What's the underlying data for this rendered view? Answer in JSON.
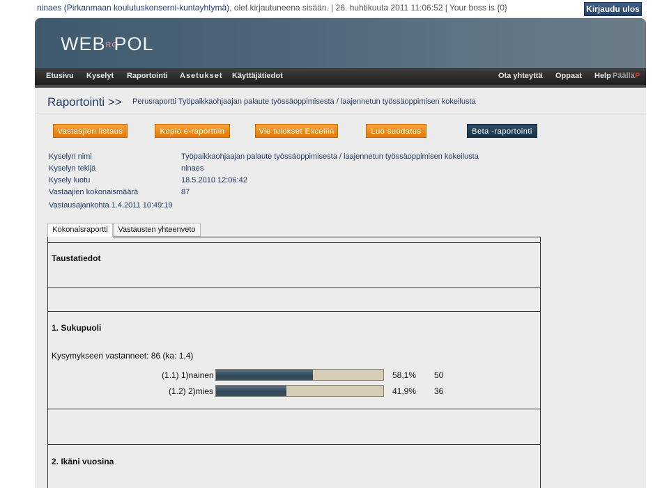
{
  "top": {
    "user_org": "ninaes (Pirkanmaan koulutuskonserni-kuntayhtymä)",
    "status_rest": ", olet kirjautuneena sisään. | 26. huhtikuuta 2011 11:06:52 | Your boss is {0}",
    "logout_label": "Kirjaudu ulos"
  },
  "logo": {
    "pre": "WEB",
    "mid": "RO",
    "post": "POL"
  },
  "nav": {
    "items": [
      "Etusivu",
      "Kyselyt",
      "Raportointi",
      "Asetukset",
      "Käyttäjätiedot"
    ],
    "right": [
      "Ota yhteyttä",
      "Oppaat",
      "Help"
    ],
    "lang_fi": "Päällä",
    "lang_flag": "P"
  },
  "breadcrumb": {
    "section": "Raportointi >>",
    "path": "Perusraportti Työpaikkaohjaajan palaute työssäoppimisesta / laajennetun työssäoppimisen kokeilusta"
  },
  "actions": [
    "Vastaajien listaus",
    "Kopio e-raporttiin",
    "Vie tulokset Exceliin",
    "Luo suodatus",
    "Beta -raportointi"
  ],
  "info": {
    "rows": [
      {
        "label": "Kyselyn nimi",
        "value": "Työpaikkaohjaajan palaute työssäoppimisesta / laajennetun työssäoppimisen kokeilusta"
      },
      {
        "label": "Kyselyn tekijä",
        "value": "ninaes"
      },
      {
        "label": "Kysely luotu",
        "value": "18.5.2010 12:06:42"
      },
      {
        "label": "Vastaajien kokonaismäärä",
        "value": "87"
      }
    ],
    "period": "Vastausajankohta 1.4.2011 10:49:19"
  },
  "tabs": [
    "Kokonaisraportti",
    "Vastausten yhteenveto"
  ],
  "report": {
    "section_title": "Taustatiedot",
    "q1": {
      "title": "1. Sukupuoli",
      "answered": "Kysymykseen vastanneet: 86 (ka: 1,4)",
      "options": [
        {
          "label": "(1.1) 1)nainen",
          "percent": "58,1%",
          "count": "50",
          "fraction": 0.581
        },
        {
          "label": "(1.2) 2)mies",
          "percent": "41,9%",
          "count": "36",
          "fraction": 0.419
        }
      ]
    },
    "q2": {
      "title": "2. Ikäni vuosina"
    }
  }
}
